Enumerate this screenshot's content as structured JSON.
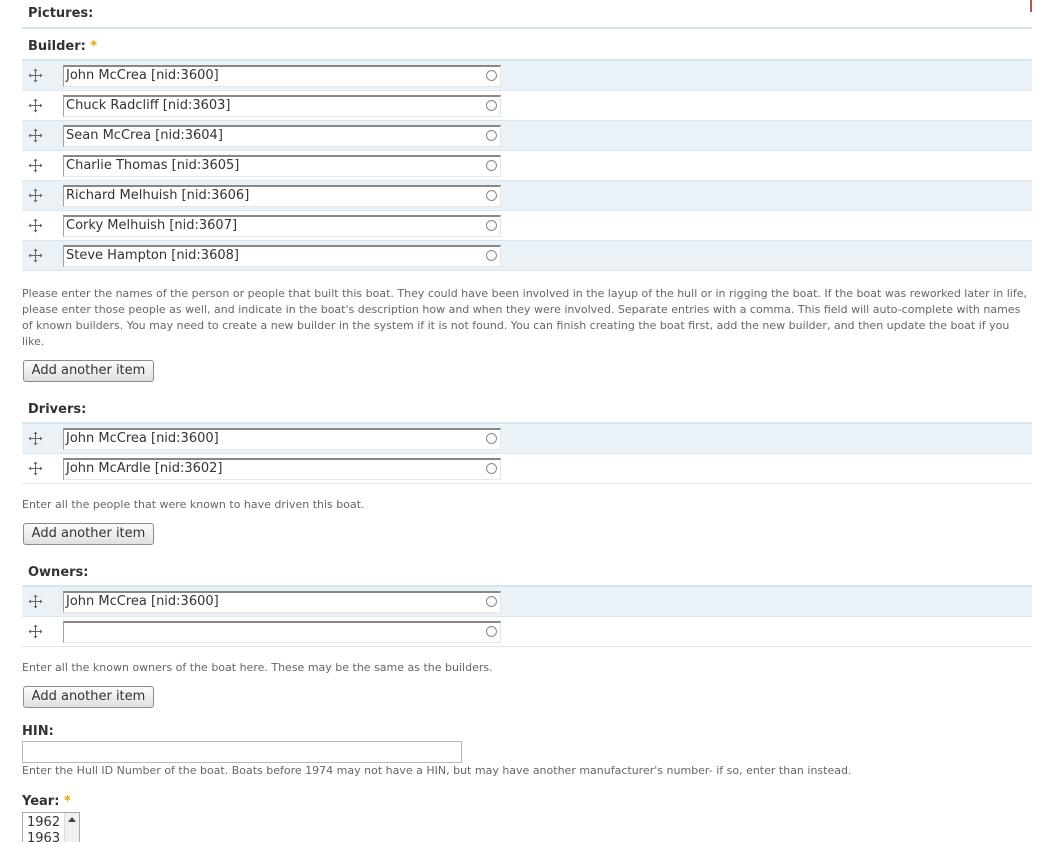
{
  "pictures": {
    "label": "Pictures:"
  },
  "builder": {
    "label": "Builder:",
    "required_mark": "*",
    "items": [
      "John McCrea [nid:3600]",
      "Chuck Radcliff [nid:3603]",
      "Sean McCrea [nid:3604]",
      "Charlie Thomas [nid:3605]",
      "Richard Melhuish [nid:3606]",
      "Corky Melhuish [nid:3607]",
      "Steve Hampton [nid:3608]"
    ],
    "description": "Please enter the names of the person or people that built this boat. They could have been involved in the layup of the hull or in rigging the boat. If the boat was reworked later in life, please enter those people as well, and indicate in the boat's description how and when they were involved. Separate entries with a comma. This field will auto-complete with names of known builders. You may need to create a new builder in the system if it is not found. You can finish creating the boat first, add the new builder, and then update the boat if you like.",
    "add_button": "Add another item"
  },
  "drivers": {
    "label": "Drivers:",
    "items": [
      "John McCrea [nid:3600]",
      "John McArdle [nid:3602]"
    ],
    "description": "Enter all the people that were known to have driven this boat.",
    "add_button": "Add another item"
  },
  "owners": {
    "label": "Owners:",
    "items": [
      "John McCrea [nid:3600]",
      ""
    ],
    "description": "Enter all the known owners of the boat here. These may be the same as the builders.",
    "add_button": "Add another item"
  },
  "hin": {
    "label": "HIN:",
    "value": "",
    "description": "Enter the Hull ID Number of the boat. Boats before 1974 may not have a HIN, but may have another manufacturer's number- if so, enter than instead."
  },
  "year": {
    "label": "Year:",
    "required_mark": "*",
    "options_visible": [
      "1962",
      "1963"
    ]
  },
  "icons": {
    "drag": "drag-handle-icon",
    "autocomplete": "autocomplete-throbber-icon"
  }
}
